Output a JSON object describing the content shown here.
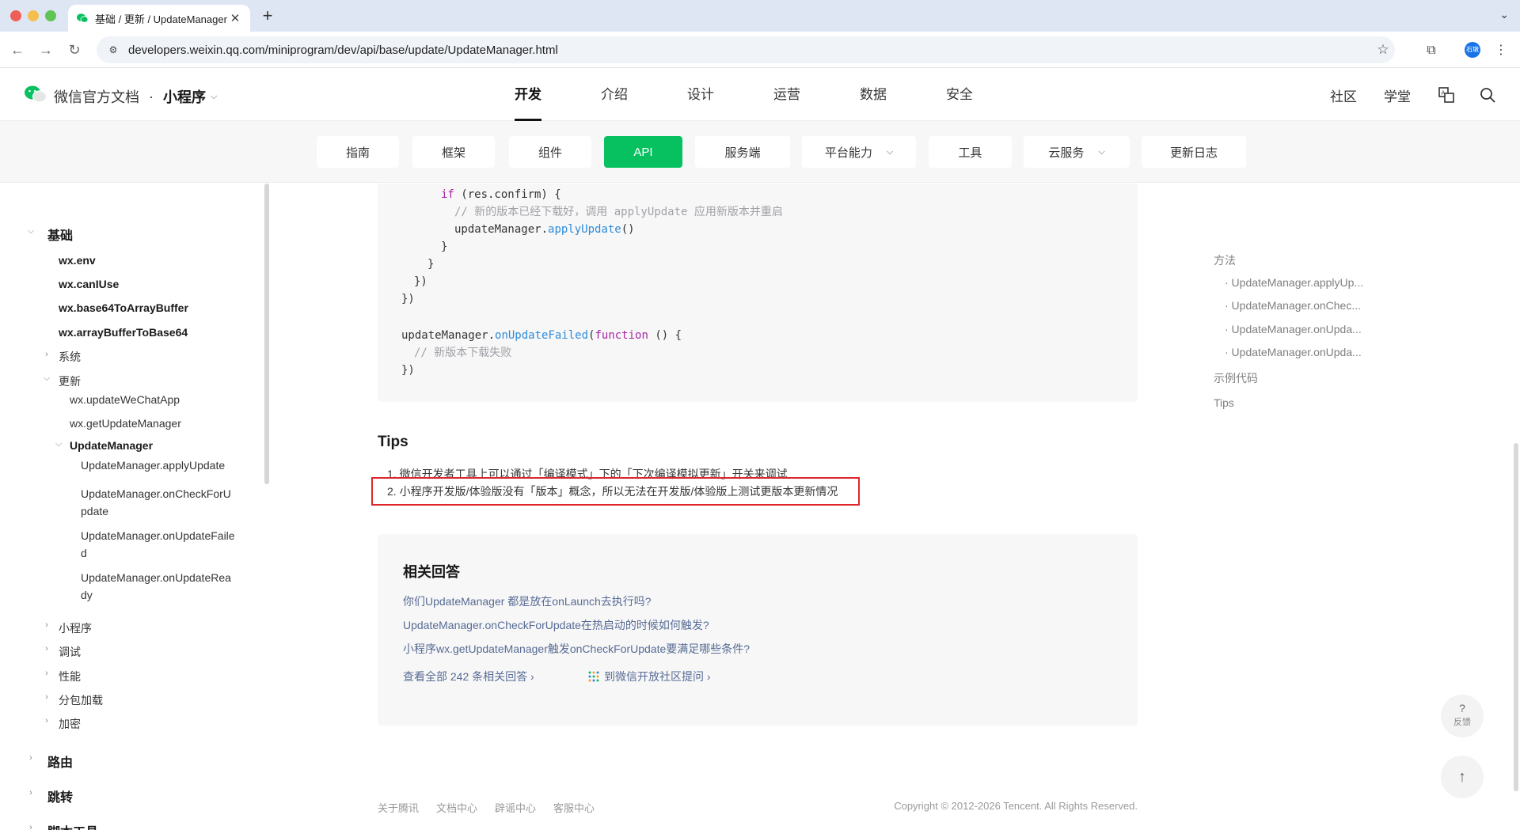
{
  "browser": {
    "tab_title": "基础 / 更新 / UpdateManager",
    "url": "developers.weixin.qq.com/miniprogram/dev/api/base/update/UpdateManager.html",
    "avatar_text": "石墩"
  },
  "header": {
    "brand": "微信官方文档",
    "dot": "·",
    "product": "小程序",
    "nav": [
      "开发",
      "介绍",
      "设计",
      "运营",
      "数据",
      "安全"
    ],
    "right": [
      "社区",
      "学堂"
    ]
  },
  "subnav": {
    "items": [
      "指南",
      "框架",
      "组件",
      "API",
      "服务端",
      "平台能力",
      "工具",
      "云服务",
      "更新日志"
    ],
    "active": "API"
  },
  "sidebar": {
    "section": "基础",
    "items": [
      "wx.env",
      "wx.canIUse",
      "wx.base64ToArrayBuffer",
      "wx.arrayBufferToBase64"
    ],
    "system": "系统",
    "update": "更新",
    "update_items": [
      "wx.updateWeChatApp",
      "wx.getUpdateManager"
    ],
    "update_manager": "UpdateManager",
    "um_items": [
      "UpdateManager.applyUpdate",
      "UpdateManager.onCheckForUpdate",
      "UpdateManager.onUpdateFailed",
      "UpdateManager.onUpdateReady"
    ],
    "um_items_wrapped": [
      "UpdateManager.onCheckForU",
      "pdate",
      "UpdateManager.onUpdateFaile",
      "d",
      "UpdateManager.onUpdateRea",
      "dy"
    ],
    "more": [
      "小程序",
      "调试",
      "性能",
      "分包加载",
      "加密"
    ],
    "sections": [
      "路由",
      "跳转",
      "脚本工具"
    ]
  },
  "code": {
    "l1_kw": "if",
    "l1_rest": " (res.confirm) {",
    "l2": "// 新的版本已经下载好，调用 applyUpdate 应用新版本并重启",
    "l3_obj": "updateManager.",
    "l3_fn": "applyUpdate",
    "l3_end": "()",
    "l4": "}",
    "l5": "}",
    "l6": "})",
    "l7": "})",
    "l8_obj": "updateManager.",
    "l8_fn": "onUpdateFailed",
    "l8_open": "(",
    "l8_kw": "function",
    "l8_end": " () {",
    "l9": "// 新版本下载失败",
    "l10": "})"
  },
  "tips": {
    "title": "Tips",
    "items": [
      "1. 微信开发者工具上可以通过「编译模式」下的「下次编译模拟更新」开关来调试",
      "2. 小程序开发版/体验版没有「版本」概念，所以无法在开发版/体验版上测试更版本更新情况"
    ]
  },
  "related": {
    "title": "相关回答",
    "links": [
      "你们UpdateManager 都是放在onLaunch去执行吗?",
      "UpdateManager.onCheckForUpdate在热启动的时候如何触发?",
      "小程序wx.getUpdateManager触发onCheckForUpdate要满足哪些条件?"
    ],
    "view_all": "查看全部 242 条相关回答",
    "ask": "到微信开放社区提问"
  },
  "toc": {
    "methods": "方法",
    "items": [
      "· UpdateManager.applyUp...",
      "· UpdateManager.onChec...",
      "· UpdateManager.onUpda...",
      "· UpdateManager.onUpda..."
    ],
    "example": "示例代码",
    "tips": "Tips"
  },
  "footer": {
    "links": [
      "关于腾讯",
      "文档中心",
      "辟谣中心",
      "客服中心"
    ],
    "copyright": "Copyright © 2012-2026 Tencent. All Rights Reserved."
  },
  "floating": {
    "feedback_q": "?",
    "feedback": "反馈",
    "top": "↑"
  },
  "colors": {
    "accent": "#07c160",
    "link": "#576b95",
    "highlight": "#e0262a"
  }
}
